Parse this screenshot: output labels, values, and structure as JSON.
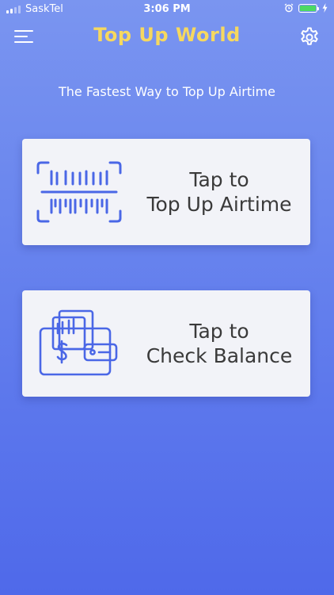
{
  "status_bar": {
    "carrier": "SaskTel",
    "time": "3:06 PM"
  },
  "header": {
    "title": "Top Up World",
    "menu_icon": "hamburger-menu-icon",
    "settings_icon": "gear-icon"
  },
  "tagline": "The Fastest Way to Top Up Airtime",
  "cards": {
    "topup": {
      "line1": "Tap to",
      "line2": "Top Up Airtime",
      "icon": "barcode-scan-icon"
    },
    "balance": {
      "line1": "Tap to",
      "line2": "Check Balance",
      "icon": "wallet-icon"
    }
  },
  "colors": {
    "title": "#f6d85f",
    "icon_blue": "#4a67e6",
    "card_bg": "#f2f3f8",
    "battery": "#4cd964"
  }
}
